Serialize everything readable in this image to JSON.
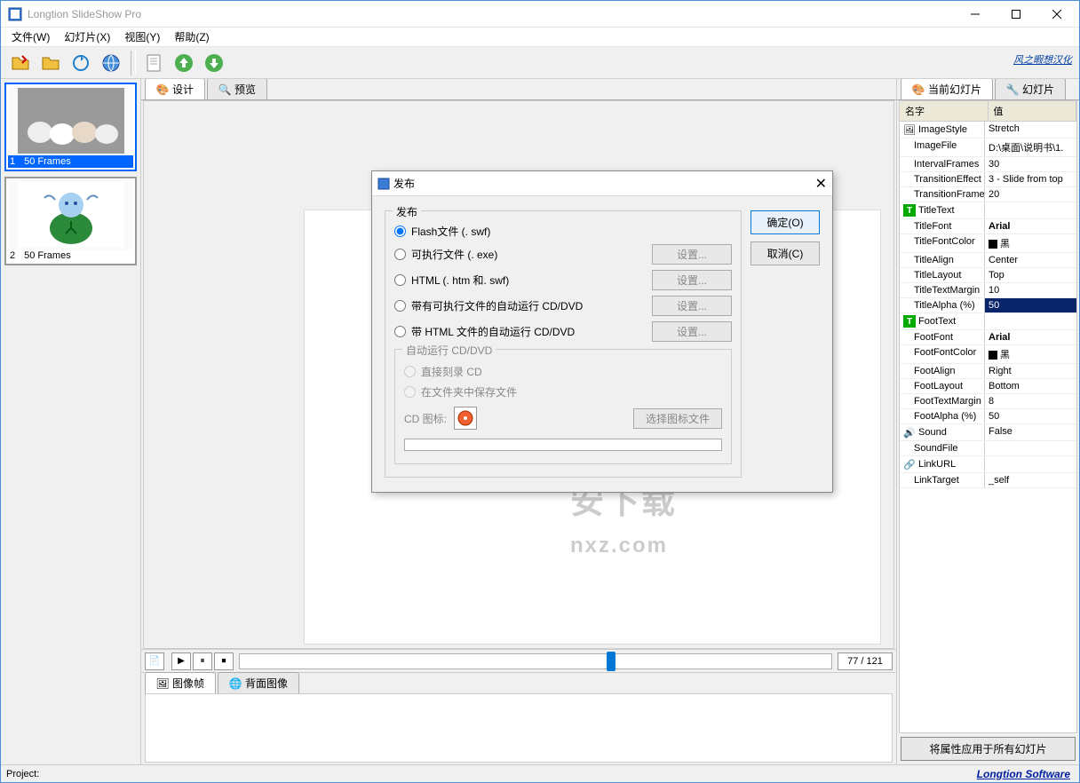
{
  "app": {
    "title": "Longtion SlideShow Pro"
  },
  "menu": {
    "file": "文件(W)",
    "slide": "幻灯片(X)",
    "view": "视图(Y)",
    "help": "帮助(Z)"
  },
  "branding": {
    "top": "风之暇想汉化",
    "bottom": "Longtion Software"
  },
  "thumbs": [
    {
      "idx": "1",
      "frames": "50 Frames"
    },
    {
      "idx": "2",
      "frames": "50 Frames"
    }
  ],
  "centerTabs": {
    "design": "设计",
    "preview": "预览"
  },
  "playback": {
    "counter": "77 / 121"
  },
  "bottomTabs": {
    "imgFrame": "图像帧",
    "bgImage": "背面图像"
  },
  "rightTabs": {
    "current": "当前幻灯片",
    "slides": "幻灯片"
  },
  "propHead": {
    "name": "名字",
    "value": "值"
  },
  "props": [
    {
      "k": "ImageStyle",
      "v": "Stretch",
      "cat": true,
      "ico": "img"
    },
    {
      "k": "ImageFile",
      "v": "D:\\桌面\\说明书\\1."
    },
    {
      "k": "IntervalFrames",
      "v": "30"
    },
    {
      "k": "TransitionEffect",
      "v": "3 - Slide from top"
    },
    {
      "k": "TransitionFrames",
      "v": "20"
    },
    {
      "k": "TitleText",
      "v": "",
      "cat": true,
      "ico": "T"
    },
    {
      "k": "TitleFont",
      "v": "Arial",
      "bold": true
    },
    {
      "k": "TitleFontColor",
      "v": "黑",
      "swatch": true
    },
    {
      "k": "TitleAlign",
      "v": "Center"
    },
    {
      "k": "TitleLayout",
      "v": "Top"
    },
    {
      "k": "TitleTextMargin",
      "v": "10"
    },
    {
      "k": "TitleAlpha (%)",
      "v": "50",
      "sel": true
    },
    {
      "k": "FootText",
      "v": "",
      "cat": true,
      "ico": "T"
    },
    {
      "k": "FootFont",
      "v": "Arial",
      "bold": true
    },
    {
      "k": "FootFontColor",
      "v": "黑",
      "swatch": true
    },
    {
      "k": "FootAlign",
      "v": "Right"
    },
    {
      "k": "FootLayout",
      "v": "Bottom"
    },
    {
      "k": "FootTextMargin",
      "v": "8"
    },
    {
      "k": "FootAlpha (%)",
      "v": "50"
    },
    {
      "k": "Sound",
      "v": "False",
      "cat": true,
      "ico": "snd"
    },
    {
      "k": "SoundFile",
      "v": ""
    },
    {
      "k": "LinkURL",
      "v": "",
      "cat": true,
      "ico": "lnk"
    },
    {
      "k": "LinkTarget",
      "v": "_self"
    }
  ],
  "applyAll": "将属性应用于所有幻灯片",
  "status": {
    "project": "Project:"
  },
  "dialog": {
    "title": "发布",
    "group": "发布",
    "opt1": "Flash文件 (. swf)",
    "opt2": "可执行文件 (. exe)",
    "opt3": "HTML (. htm 和. swf)",
    "opt4": "带有可执行文件的自动运行 CD/DVD",
    "opt5": "带 HTML 文件的自动运行 CD/DVD",
    "set": "设置...",
    "cdgroup": "自动运行 CD/DVD",
    "cd1": "直接刻录 CD",
    "cd2": "在文件夹中保存文件",
    "cdico": "CD 图标:",
    "selico": "选择图标文件",
    "ok": "确定(O)",
    "cancel": "取消(C)"
  },
  "watermark": "安下载\nnxz.com"
}
